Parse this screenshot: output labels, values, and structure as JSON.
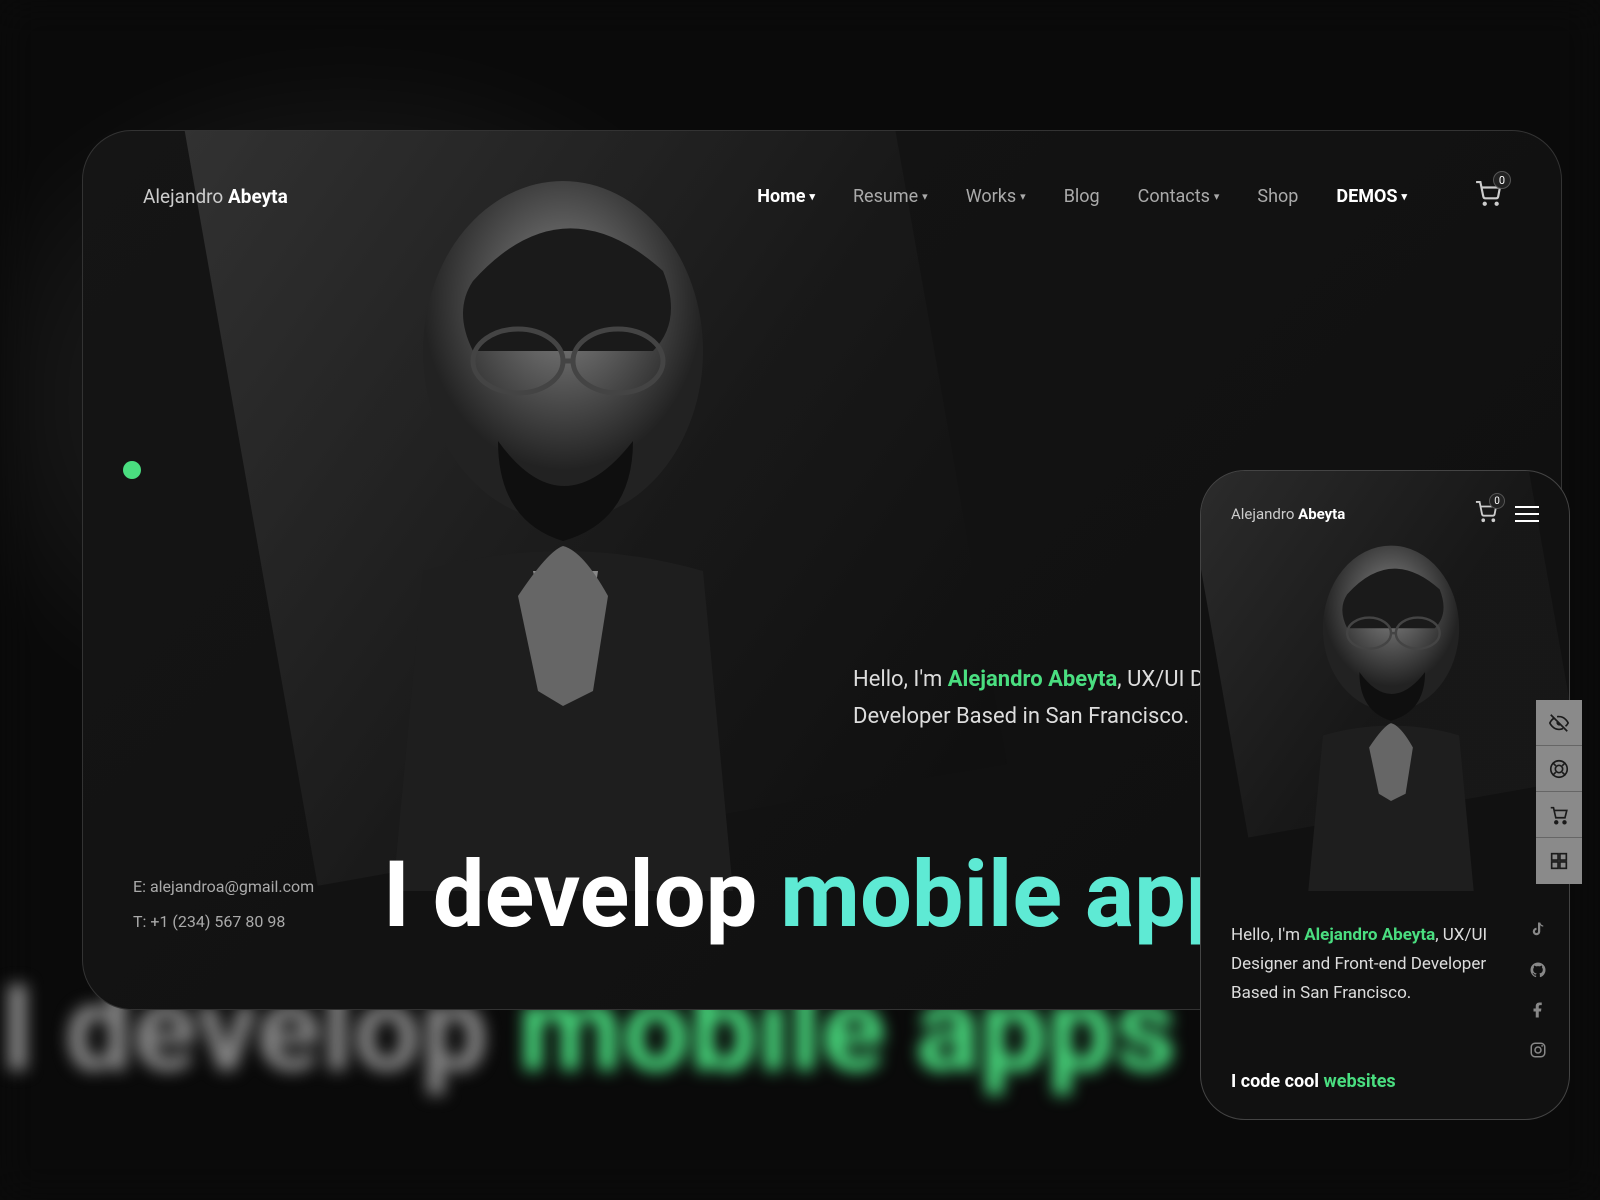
{
  "brand": {
    "first": "Alejandro",
    "last": "Abeyta"
  },
  "nav": {
    "items": [
      {
        "label": "Home",
        "active": true,
        "dropdown": true
      },
      {
        "label": "Resume",
        "active": false,
        "dropdown": true
      },
      {
        "label": "Works",
        "active": false,
        "dropdown": true
      },
      {
        "label": "Blog",
        "active": false,
        "dropdown": false
      },
      {
        "label": "Contacts",
        "active": false,
        "dropdown": true
      },
      {
        "label": "Shop",
        "active": false,
        "dropdown": false
      },
      {
        "label": "DEMOS",
        "active": false,
        "dropdown": true,
        "demos": true
      }
    ],
    "cart_count": "0"
  },
  "intro": {
    "hello": "Hello, I'm ",
    "name": "Alejandro Abeyta",
    "rest": ", UX/UI Designer and Front-end Developer Based in San Francisco."
  },
  "contact": {
    "email": "E: alejandroa@gmail.com",
    "phone": "T: +1 (234) 567 80 98"
  },
  "headline": {
    "a": "I develop ",
    "b": "mobile apps"
  },
  "mobile": {
    "cart_count": "0",
    "tag_a": "I code cool ",
    "tag_b": "websites"
  },
  "bg_headline": {
    "a": "I develop ",
    "b": "mobile apps"
  },
  "accent_color": "#4ade80"
}
